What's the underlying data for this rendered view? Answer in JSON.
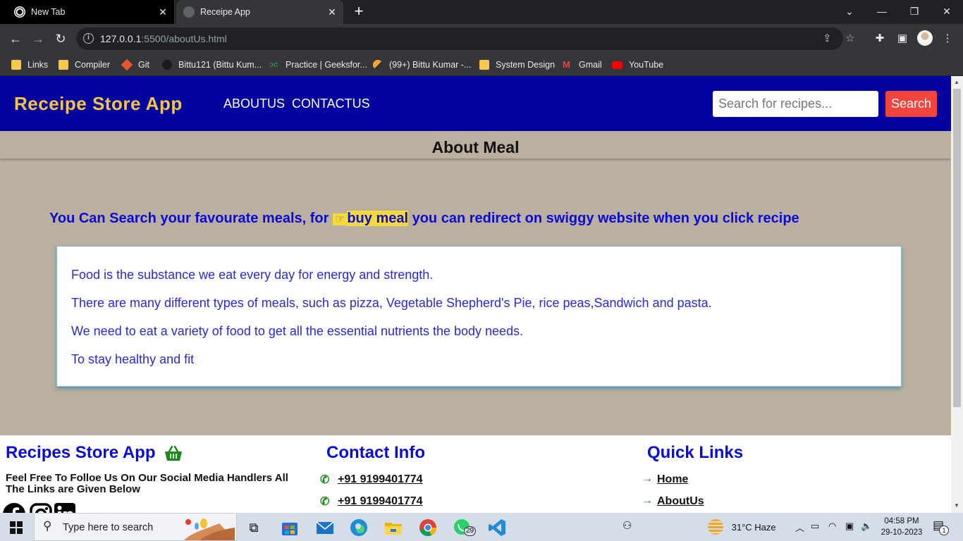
{
  "browser": {
    "tabs": [
      {
        "title": "New Tab"
      },
      {
        "title": "Receipe App"
      }
    ],
    "url_host": "127.0.0.1",
    "url_rest": ":5500/aboutUs.html",
    "bookmarks": [
      "Links",
      "Compiler",
      "Git",
      "Bittu121 (Bittu Kum...",
      "Practice | Geeksfor...",
      "(99+) Bittu Kumar -...",
      "System Design",
      "Gmail",
      "YouTube"
    ]
  },
  "page": {
    "brand": "Receipe Store App",
    "nav": [
      "ABOUTUS",
      "CONTACTUS"
    ],
    "search_placeholder": "Search for recipes...",
    "search_button": "Search",
    "about_title": "About Meal",
    "tagline_pre": "You Can Search your favourate meals, for",
    "tagline_hand": "☞",
    "tagline_highlight": "buy meal",
    "tagline_post": "you can redirect on swiggy website when you click recipe",
    "paragraphs": [
      "Food is the substance we eat every day for energy and strength.",
      "There are many different types of meals, such as pizza, Vegetable Shepherd's Pie, rice peas,Sandwich and pasta.",
      "We need to eat a variety of food to get all the essential nutrients the body needs.",
      "To stay healthy and fit"
    ]
  },
  "footer": {
    "col1_title": "Recipes Store App",
    "follow_text": "Feel Free To Folloe Us On Our Social Media Handlers All The Links are Given Below",
    "col2_title": "Contact Info",
    "phones": [
      "+91 9199401774",
      "+91 9199401774"
    ],
    "col3_title": "Quick Links",
    "links": [
      "Home",
      "AboutUs"
    ]
  },
  "taskbar": {
    "search_text": "Type here to search",
    "whatsapp_badge": "29",
    "weather": "31°C  Haze",
    "time": "04:58 PM",
    "date": "29-10-2023",
    "notif_count": "1"
  },
  "colors": {
    "navbar": "#0303a0",
    "brand": "#f4c542",
    "page_bg": "#bbafa0",
    "link_blue": "#0a0ad8",
    "search_btn": "#f3453d",
    "highlight": "#f6d93a"
  }
}
